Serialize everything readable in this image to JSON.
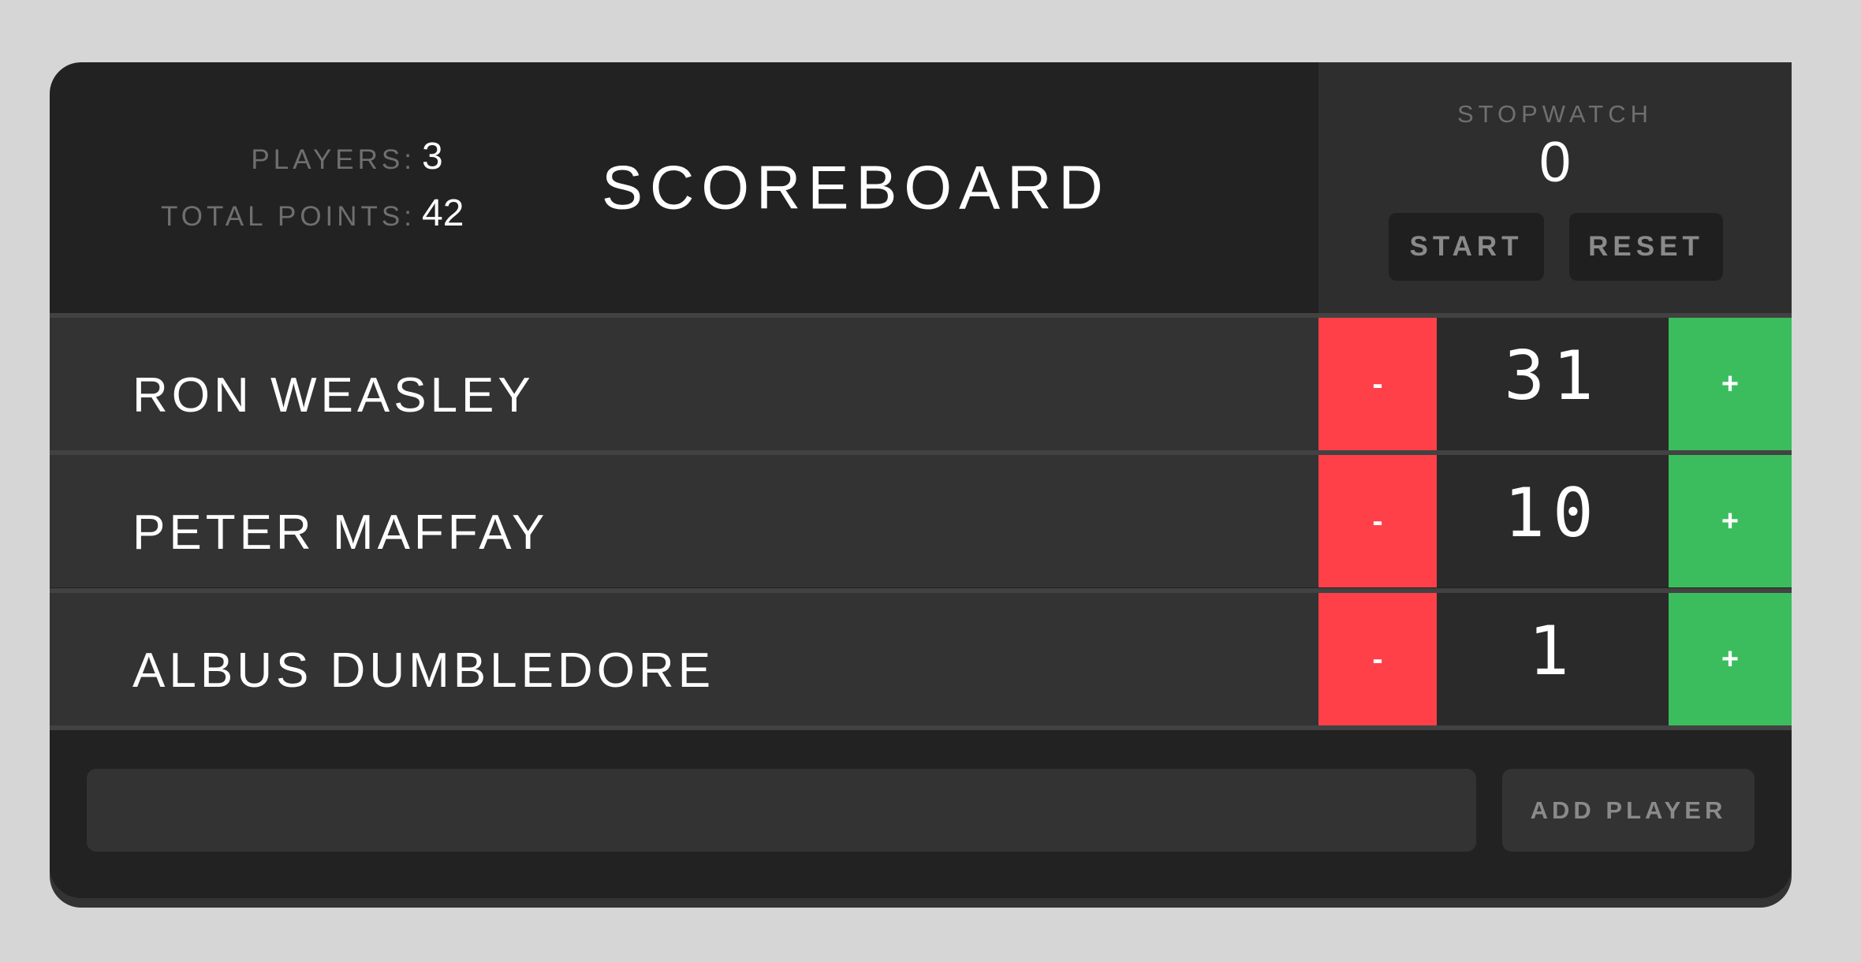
{
  "header": {
    "players_label": "PLAYERS:",
    "players_count": "3",
    "total_points_label": "TOTAL POINTS:",
    "total_points": "42",
    "title": "SCOREBOARD"
  },
  "stopwatch": {
    "label": "STOPWATCH",
    "time": "0",
    "start_label": "START",
    "reset_label": "RESET"
  },
  "players": [
    {
      "name": "RON WEASLEY",
      "score": "31",
      "decrement_label": "-",
      "increment_label": "+"
    },
    {
      "name": "PETER MAFFAY",
      "score": "10",
      "decrement_label": "-",
      "increment_label": "+"
    },
    {
      "name": "ALBUS DUMBLEDORE",
      "score": "1",
      "decrement_label": "-",
      "increment_label": "+"
    }
  ],
  "footer": {
    "input_value": "",
    "input_placeholder": "",
    "add_player_label": "ADD PLAYER"
  },
  "colors": {
    "background": "#d6d6d6",
    "board": "#222222",
    "row": "#333333",
    "decrement": "#ff4049",
    "increment": "#3bbd5e"
  }
}
